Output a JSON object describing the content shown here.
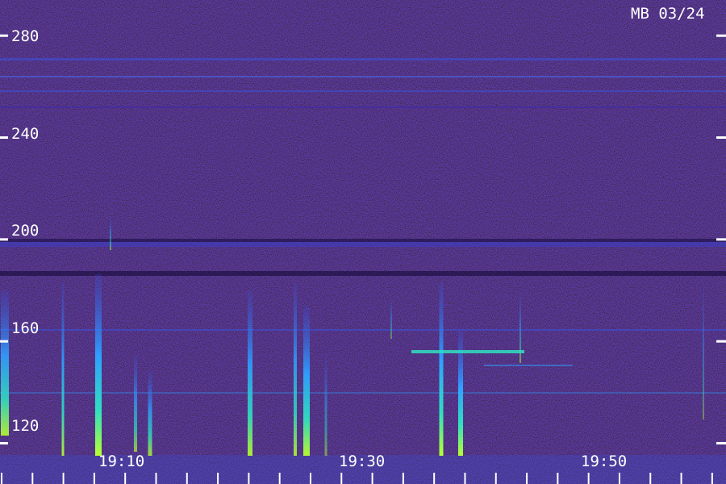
{
  "corner_label": "MB 03/24",
  "chart_data": {
    "type": "heatmap",
    "title": "",
    "xlabel": "",
    "ylabel": "",
    "y_ticks": [
      "280",
      "240",
      "200",
      "160",
      "120"
    ],
    "y_tick_values": [
      280,
      240,
      200,
      160,
      120
    ],
    "ylim": [
      104,
      294
    ],
    "x_ticks": [
      "19:10",
      "19:30",
      "19:50"
    ],
    "colormap": [
      "#2a1670",
      "#3b28b0",
      "#3a55e0",
      "#2fa0ff",
      "#2fe0c0",
      "#b8ff30"
    ],
    "minor_x_ticks_count": 24
  }
}
